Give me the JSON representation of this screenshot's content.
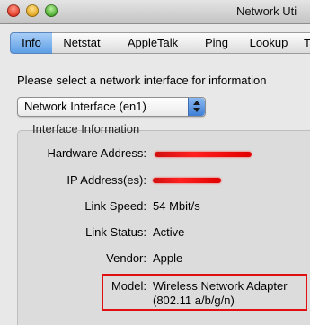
{
  "window": {
    "title": "Network Uti",
    "buttons": [
      "close",
      "minimize",
      "zoom"
    ]
  },
  "tabs": [
    {
      "label": "Info",
      "selected": true
    },
    {
      "label": "Netstat",
      "selected": false
    },
    {
      "label": "AppleTalk",
      "selected": false
    },
    {
      "label": "Ping",
      "selected": false
    },
    {
      "label": "Lookup",
      "selected": false
    },
    {
      "label": "T",
      "selected": false
    }
  ],
  "prompt": "Please select a network interface for information",
  "interface_select": {
    "value": "Network Interface (en1)"
  },
  "interface_info": {
    "group_label": "Interface Information",
    "hardware_address_label": "Hardware Address:",
    "ip_addresses_label": "IP Address(es):",
    "link_speed_label": "Link Speed:",
    "link_speed_value": "54 Mbit/s",
    "link_status_label": "Link Status:",
    "link_status_value": "Active",
    "vendor_label": "Vendor:",
    "vendor_value": "Apple",
    "model_label": "Model:",
    "model_value_line1": "Wireless Network Adapter",
    "model_value_line2": "(802.11 a/b/g/n)"
  },
  "annotations": {
    "redaction_color": "#ff0000",
    "highlight_color": "#e01010"
  }
}
